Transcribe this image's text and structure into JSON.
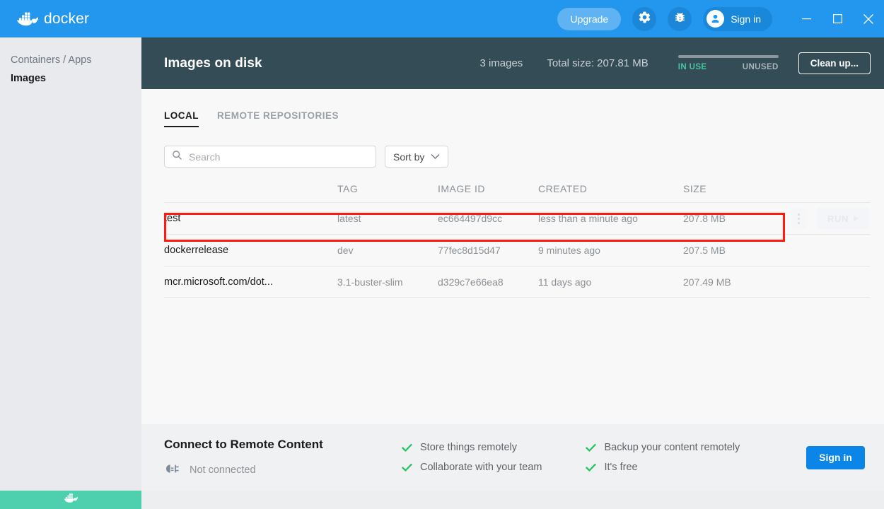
{
  "titlebar": {
    "brand": "docker",
    "brand_icon": "docker-whale-logo",
    "upgrade_label": "Upgrade",
    "settings_icon": "gear-icon",
    "troubleshoot_icon": "bug-icon",
    "signin_label": "Sign in",
    "avatar_icon": "user-icon",
    "minimize_icon": "minimize-icon",
    "maximize_icon": "maximize-icon",
    "close_icon": "close-icon",
    "bg_color": "#2396ed"
  },
  "sidebar": {
    "items": [
      {
        "label": "Containers / Apps",
        "active": false
      },
      {
        "label": "Images",
        "active": true
      }
    ]
  },
  "pageheader": {
    "title": "Images on disk",
    "image_count": "3 images",
    "total_size": "Total size: 207.81 MB",
    "meter": {
      "in_use_label": "IN USE",
      "unused_label": "UNUSED",
      "in_use_color": "#4bc3a0",
      "unused_color": "#a9b4b9"
    },
    "cleanup_label": "Clean up...",
    "bg_color": "#344c56"
  },
  "tabs": [
    {
      "label": "LOCAL",
      "active": true
    },
    {
      "label": "REMOTE REPOSITORIES",
      "active": false
    }
  ],
  "controls": {
    "search_placeholder": "Search",
    "search_value": "",
    "search_icon": "search-icon",
    "sort_label": "Sort by",
    "sort_chevron_icon": "chevron-down-icon"
  },
  "table": {
    "columns": [
      "",
      "TAG",
      "IMAGE ID",
      "CREATED",
      "SIZE"
    ],
    "rows": [
      {
        "name": "test",
        "tag": "latest",
        "image_id": "ec664497d9cc",
        "created": "less than a minute ago",
        "size": "207.8 MB",
        "highlighted": true,
        "menu_icon": "more-vertical-icon",
        "run_label": "RUN",
        "run_icon": "play-icon"
      },
      {
        "name": "dockerrelease",
        "tag": "dev",
        "image_id": "77fec8d15d47",
        "created": "9 minutes ago",
        "size": "207.5 MB",
        "highlighted": false
      },
      {
        "name": "mcr.microsoft.com/dot...",
        "tag": "3.1-buster-slim",
        "image_id": "d329c7e66ea8",
        "created": "11 days ago",
        "size": "207.49 MB",
        "highlighted": false
      }
    ],
    "highlight_color": "#ff1a10"
  },
  "footer": {
    "title": "Connect to Remote Content",
    "status_icon": "unplugged-icon",
    "status_label": "Not connected",
    "features_col1": [
      "Store things remotely",
      "Collaborate with your team"
    ],
    "features_col2": [
      "Backup your content remotely",
      "It's free"
    ],
    "check_icon": "check-icon",
    "check_color": "#21c45d",
    "signin_label": "Sign in",
    "signin_color": "#0b85e8"
  },
  "statusbar": {
    "icon": "docker-whale-icon",
    "color": "#4ecfae"
  }
}
